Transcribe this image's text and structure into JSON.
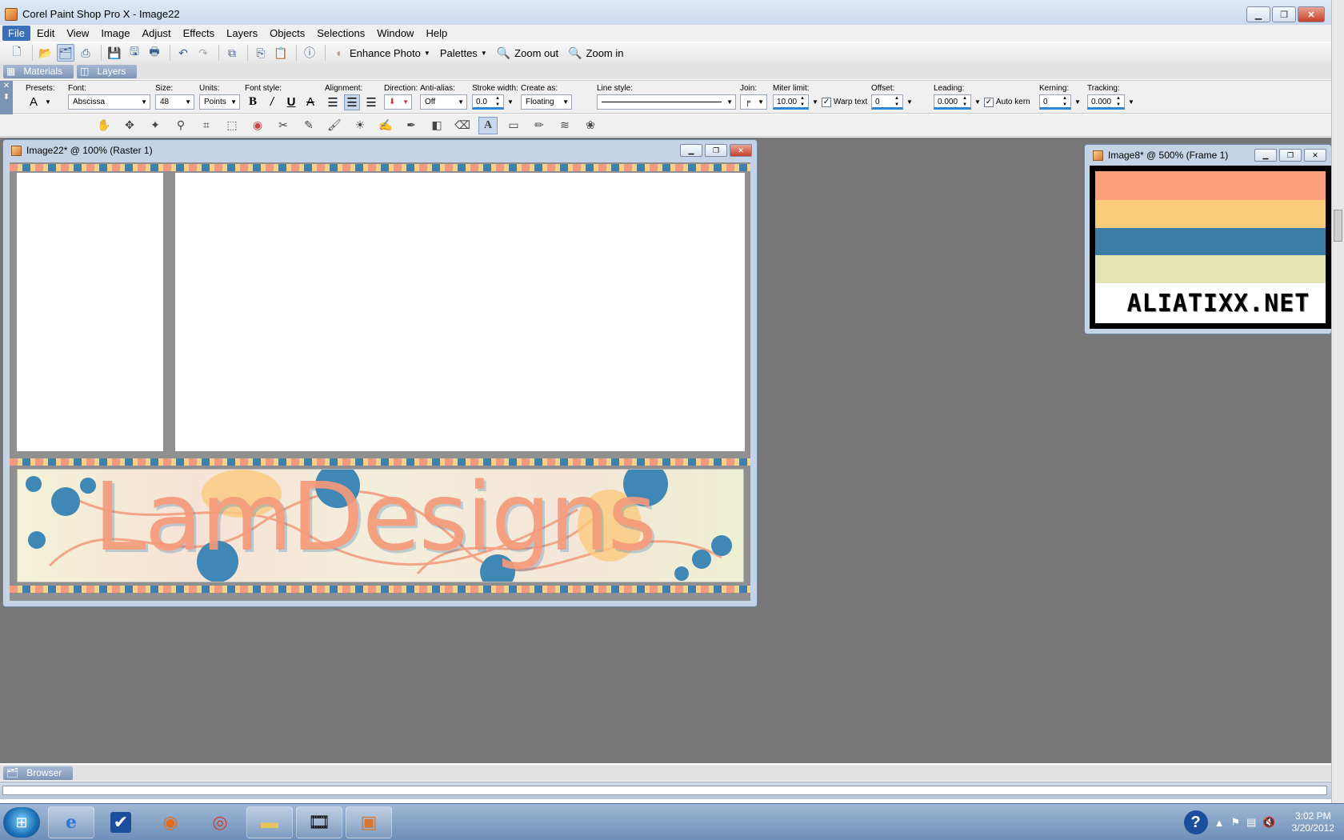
{
  "window": {
    "title": "Corel Paint Shop Pro X - Image22",
    "min_label": "▁",
    "max_label": "❐",
    "close_label": "✕"
  },
  "menu": [
    "File",
    "Edit",
    "View",
    "Image",
    "Adjust",
    "Effects",
    "Layers",
    "Objects",
    "Selections",
    "Window",
    "Help"
  ],
  "toolbar": {
    "enhance_photo": "Enhance Photo",
    "palettes": "Palettes",
    "zoom_out": "Zoom out",
    "zoom_in": "Zoom in"
  },
  "palette_tabs": {
    "materials": "Materials",
    "layers": "Layers"
  },
  "text_options": {
    "presets_label": "Presets:",
    "font_label": "Font:",
    "font_value": "Abscissa",
    "size_label": "Size:",
    "size_value": "48",
    "units_label": "Units:",
    "units_value": "Points",
    "font_style_label": "Font style:",
    "alignment_label": "Alignment:",
    "direction_label": "Direction:",
    "antialias_label": "Anti-alias:",
    "antialias_value": "Off",
    "stroke_label": "Stroke width:",
    "stroke_value": "0.0",
    "create_as_label": "Create as:",
    "create_as_value": "Floating",
    "line_style_label": "Line style:",
    "join_label": "Join:",
    "miter_label": "Miter limit:",
    "miter_value": "10.00",
    "warp_text_label": "Warp text",
    "offset_label": "Offset:",
    "offset_value": "0",
    "leading_label": "Leading:",
    "leading_value": "0.000",
    "auto_kern_label": "Auto kern",
    "kerning_label": "Kerning:",
    "kerning_value": "0",
    "tracking_label": "Tracking:",
    "tracking_value": "0.000"
  },
  "documents": {
    "doc1_title": "Image22* @ 100% (Raster 1)",
    "doc1_banner_text": "LamDesigns",
    "doc2_title": "Image8* @ 500% (Frame 1)",
    "doc2_text": "ALIATIXX.NET",
    "doc2_colors": [
      "#fda07e",
      "#fbcb7c",
      "#3b7ea7",
      "#e3e6b3",
      "#ffffff"
    ]
  },
  "browser_tab": "Browser",
  "taskbar": {
    "time": "3:02 PM",
    "date": "3/20/2012",
    "help": "?"
  }
}
